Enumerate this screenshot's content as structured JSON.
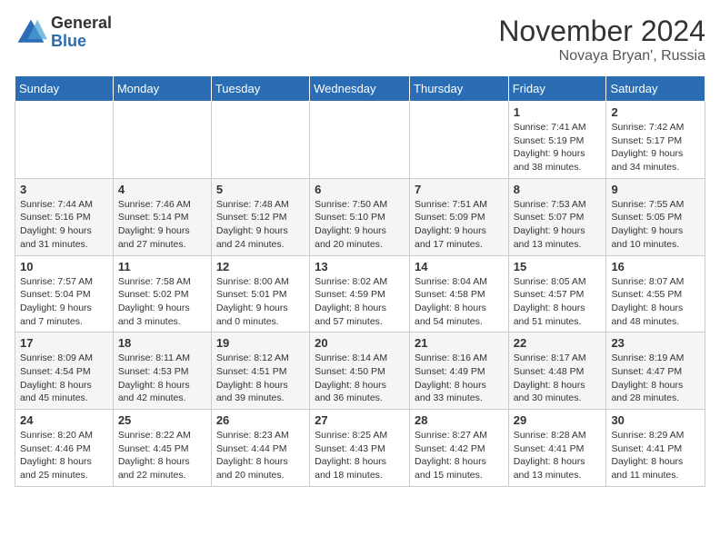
{
  "logo": {
    "general": "General",
    "blue": "Blue"
  },
  "header": {
    "month": "November 2024",
    "location": "Novaya Bryan', Russia"
  },
  "weekdays": [
    "Sunday",
    "Monday",
    "Tuesday",
    "Wednesday",
    "Thursday",
    "Friday",
    "Saturday"
  ],
  "weeks": [
    [
      {
        "day": "",
        "info": ""
      },
      {
        "day": "",
        "info": ""
      },
      {
        "day": "",
        "info": ""
      },
      {
        "day": "",
        "info": ""
      },
      {
        "day": "",
        "info": ""
      },
      {
        "day": "1",
        "info": "Sunrise: 7:41 AM\nSunset: 5:19 PM\nDaylight: 9 hours and 38 minutes."
      },
      {
        "day": "2",
        "info": "Sunrise: 7:42 AM\nSunset: 5:17 PM\nDaylight: 9 hours and 34 minutes."
      }
    ],
    [
      {
        "day": "3",
        "info": "Sunrise: 7:44 AM\nSunset: 5:16 PM\nDaylight: 9 hours and 31 minutes."
      },
      {
        "day": "4",
        "info": "Sunrise: 7:46 AM\nSunset: 5:14 PM\nDaylight: 9 hours and 27 minutes."
      },
      {
        "day": "5",
        "info": "Sunrise: 7:48 AM\nSunset: 5:12 PM\nDaylight: 9 hours and 24 minutes."
      },
      {
        "day": "6",
        "info": "Sunrise: 7:50 AM\nSunset: 5:10 PM\nDaylight: 9 hours and 20 minutes."
      },
      {
        "day": "7",
        "info": "Sunrise: 7:51 AM\nSunset: 5:09 PM\nDaylight: 9 hours and 17 minutes."
      },
      {
        "day": "8",
        "info": "Sunrise: 7:53 AM\nSunset: 5:07 PM\nDaylight: 9 hours and 13 minutes."
      },
      {
        "day": "9",
        "info": "Sunrise: 7:55 AM\nSunset: 5:05 PM\nDaylight: 9 hours and 10 minutes."
      }
    ],
    [
      {
        "day": "10",
        "info": "Sunrise: 7:57 AM\nSunset: 5:04 PM\nDaylight: 9 hours and 7 minutes."
      },
      {
        "day": "11",
        "info": "Sunrise: 7:58 AM\nSunset: 5:02 PM\nDaylight: 9 hours and 3 minutes."
      },
      {
        "day": "12",
        "info": "Sunrise: 8:00 AM\nSunset: 5:01 PM\nDaylight: 9 hours and 0 minutes."
      },
      {
        "day": "13",
        "info": "Sunrise: 8:02 AM\nSunset: 4:59 PM\nDaylight: 8 hours and 57 minutes."
      },
      {
        "day": "14",
        "info": "Sunrise: 8:04 AM\nSunset: 4:58 PM\nDaylight: 8 hours and 54 minutes."
      },
      {
        "day": "15",
        "info": "Sunrise: 8:05 AM\nSunset: 4:57 PM\nDaylight: 8 hours and 51 minutes."
      },
      {
        "day": "16",
        "info": "Sunrise: 8:07 AM\nSunset: 4:55 PM\nDaylight: 8 hours and 48 minutes."
      }
    ],
    [
      {
        "day": "17",
        "info": "Sunrise: 8:09 AM\nSunset: 4:54 PM\nDaylight: 8 hours and 45 minutes."
      },
      {
        "day": "18",
        "info": "Sunrise: 8:11 AM\nSunset: 4:53 PM\nDaylight: 8 hours and 42 minutes."
      },
      {
        "day": "19",
        "info": "Sunrise: 8:12 AM\nSunset: 4:51 PM\nDaylight: 8 hours and 39 minutes."
      },
      {
        "day": "20",
        "info": "Sunrise: 8:14 AM\nSunset: 4:50 PM\nDaylight: 8 hours and 36 minutes."
      },
      {
        "day": "21",
        "info": "Sunrise: 8:16 AM\nSunset: 4:49 PM\nDaylight: 8 hours and 33 minutes."
      },
      {
        "day": "22",
        "info": "Sunrise: 8:17 AM\nSunset: 4:48 PM\nDaylight: 8 hours and 30 minutes."
      },
      {
        "day": "23",
        "info": "Sunrise: 8:19 AM\nSunset: 4:47 PM\nDaylight: 8 hours and 28 minutes."
      }
    ],
    [
      {
        "day": "24",
        "info": "Sunrise: 8:20 AM\nSunset: 4:46 PM\nDaylight: 8 hours and 25 minutes."
      },
      {
        "day": "25",
        "info": "Sunrise: 8:22 AM\nSunset: 4:45 PM\nDaylight: 8 hours and 22 minutes."
      },
      {
        "day": "26",
        "info": "Sunrise: 8:23 AM\nSunset: 4:44 PM\nDaylight: 8 hours and 20 minutes."
      },
      {
        "day": "27",
        "info": "Sunrise: 8:25 AM\nSunset: 4:43 PM\nDaylight: 8 hours and 18 minutes."
      },
      {
        "day": "28",
        "info": "Sunrise: 8:27 AM\nSunset: 4:42 PM\nDaylight: 8 hours and 15 minutes."
      },
      {
        "day": "29",
        "info": "Sunrise: 8:28 AM\nSunset: 4:41 PM\nDaylight: 8 hours and 13 minutes."
      },
      {
        "day": "30",
        "info": "Sunrise: 8:29 AM\nSunset: 4:41 PM\nDaylight: 8 hours and 11 minutes."
      }
    ]
  ]
}
